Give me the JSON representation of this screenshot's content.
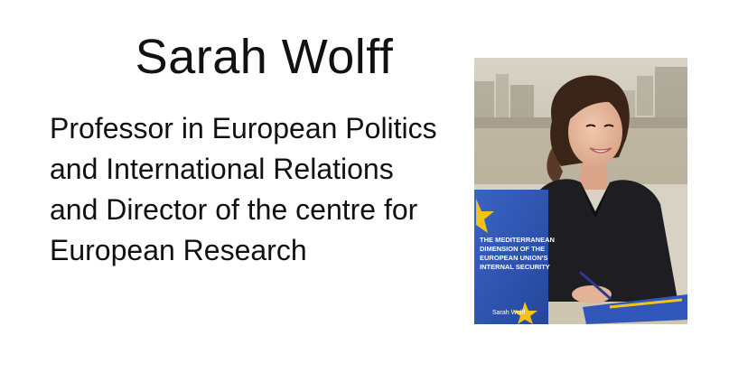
{
  "slide": {
    "title": "Sarah Wolff",
    "bio": "Professor in European Politics and International Relations and Director of the centre for European Research"
  },
  "photo": {
    "book_title_lines": [
      "THE MEDITERRANEAN",
      "DIMENSION OF THE",
      "EUROPEAN UNION'S",
      "INTERNAL SECURITY"
    ],
    "book_author": "Sarah Wolff"
  },
  "colors": {
    "background": "#ffffff",
    "text": "#111111",
    "book_blue": "#2f56b8",
    "jacket": "#1d1d22",
    "sky": "#cfcabb"
  }
}
